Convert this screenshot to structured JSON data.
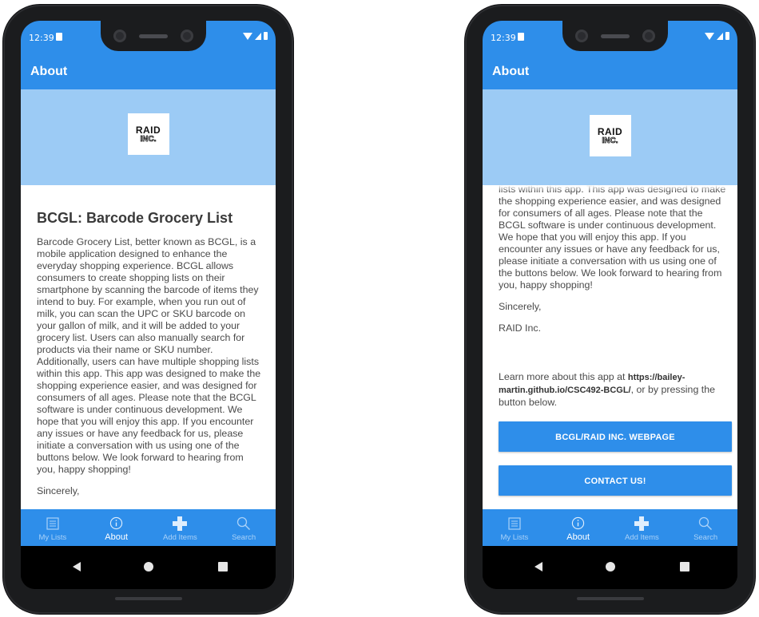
{
  "status": {
    "time": "12:39"
  },
  "appbar": {
    "title": "About"
  },
  "logo": {
    "line1": "RAID",
    "line2": "INC."
  },
  "about": {
    "heading": "BCGL: Barcode Grocery List",
    "paragraph": "Barcode Grocery List, better known as BCGL, is a mobile application designed to enhance the everyday shopping experience. BCGL allows consumers to create shopping lists on their smartphone by scanning the barcode of items they intend to buy. For example, when you run out of milk, you can scan the UPC or SKU barcode on your gallon of milk, and it will be added to your grocery list. Users can also manually search for products via their name or SKU number. Additionally, users can have multiple shopping lists within this app. This app was designed to make the shopping experience easier, and was designed for consumers of all ages. Please note that the BCGL software is under continuous development. We hope that you will enjoy this app. If you encounter any issues or have any feedback for us, please initiate a conversation with us using one of the buttons below. We look forward to hearing from you, happy shopping!",
    "paragraph_tail": "lists within this app. This app was designed to make the shopping experience easier, and was designed for consumers of all ages. Please note that the BCGL software is under continuous development. We hope that you will enjoy this app. If you encounter any issues or have any feedback for us, please initiate a conversation with us using one of the buttons below. We look forward to hearing from you, happy shopping!",
    "closing": "Sincerely,",
    "signature": "RAID Inc.",
    "learn_prefix": "Learn more about this app at ",
    "learn_url": "https://bailey-martin.github.io/CSC492-BCGL/",
    "learn_suffix": ", or by pressing the button below."
  },
  "buttons": {
    "webpage": "BCGL/RAID INC. WEBPAGE",
    "contact": "CONTACT US!"
  },
  "tabs": [
    {
      "label": "My Lists",
      "icon": "list-icon"
    },
    {
      "label": "About",
      "icon": "info-icon"
    },
    {
      "label": "Add Items",
      "icon": "plus-icon"
    },
    {
      "label": "Search",
      "icon": "search-icon"
    }
  ],
  "colors": {
    "primary": "#2e8eea",
    "hero": "#9ccbf5"
  }
}
